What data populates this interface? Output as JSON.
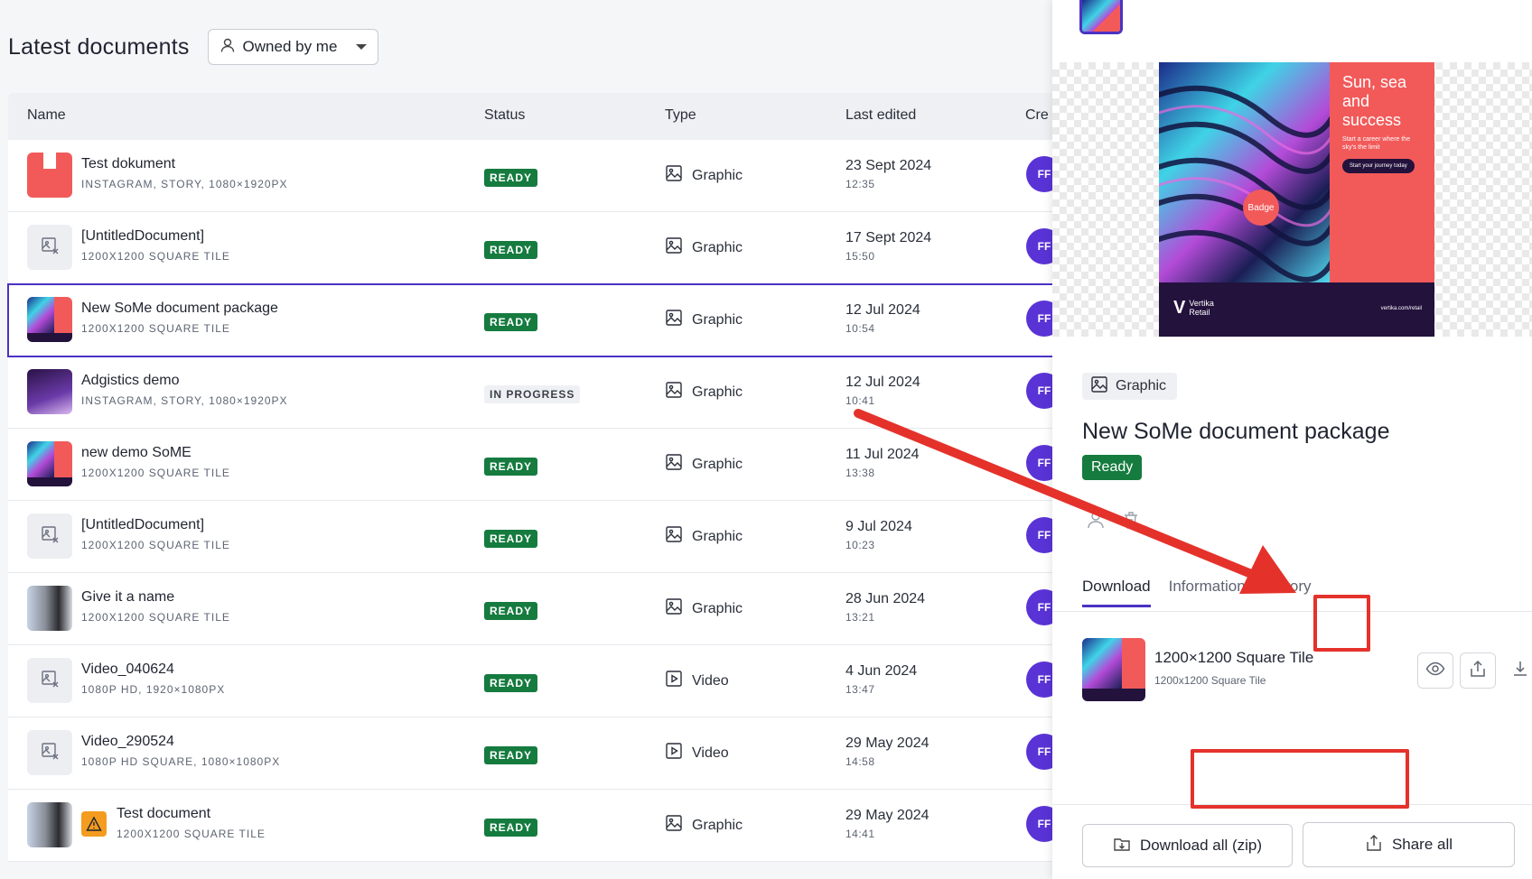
{
  "header": {
    "title": "Latest documents",
    "owner_filter": "Owned by me"
  },
  "columns": {
    "name": "Name",
    "status": "Status",
    "type": "Type",
    "last_edited": "Last edited",
    "created": "Cre"
  },
  "rows": [
    {
      "title": "Test dokument",
      "sub": "INSTAGRAM, STORY, 1080×1920PX",
      "status": "READY",
      "type": "Graphic",
      "date": "23 Sept 2024",
      "time": "12:35",
      "avatar": "FF",
      "thumb": "story-red"
    },
    {
      "title": "[UntitledDocument]",
      "sub": "1200X1200 SQUARE TILE",
      "status": "READY",
      "type": "Graphic",
      "date": "17 Sept 2024",
      "time": "15:50",
      "avatar": "FF",
      "thumb": "placeholder"
    },
    {
      "title": "New SoMe document package",
      "sub": "1200X1200 SQUARE TILE",
      "status": "READY",
      "type": "Graphic",
      "date": "12 Jul 2024",
      "time": "10:54",
      "avatar": "FF",
      "thumb": "poster",
      "selected": true
    },
    {
      "title": "Adgistics demo",
      "sub": "INSTAGRAM, STORY, 1080×1920PX",
      "status": "IN PROGRESS",
      "type": "Graphic",
      "date": "12 Jul 2024",
      "time": "10:41",
      "avatar": "FF",
      "thumb": "purple"
    },
    {
      "title": "new demo SoME",
      "sub": "1200X1200 SQUARE TILE",
      "status": "READY",
      "type": "Graphic",
      "date": "11 Jul 2024",
      "time": "13:38",
      "avatar": "FF",
      "thumb": "poster"
    },
    {
      "title": "[UntitledDocument]",
      "sub": "1200X1200 SQUARE TILE",
      "status": "READY",
      "type": "Graphic",
      "date": "9 Jul 2024",
      "time": "10:23",
      "avatar": "FF",
      "thumb": "placeholder"
    },
    {
      "title": "Give it a name",
      "sub": "1200X1200 SQUARE TILE",
      "status": "READY",
      "type": "Graphic",
      "date": "28 Jun 2024",
      "time": "13:21",
      "avatar": "FF",
      "thumb": "people"
    },
    {
      "title": "Video_040624",
      "sub": "1080P HD, 1920×1080PX",
      "status": "READY",
      "type": "Video",
      "date": "4 Jun 2024",
      "time": "13:47",
      "avatar": "FF",
      "thumb": "placeholder"
    },
    {
      "title": "Video_290524",
      "sub": "1080P HD SQUARE, 1080×1080PX",
      "status": "READY",
      "type": "Video",
      "date": "29 May 2024",
      "time": "14:58",
      "avatar": "FF",
      "thumb": "placeholder"
    },
    {
      "title": "Test document",
      "sub": "1200X1200 SQUARE TILE",
      "status": "READY",
      "type": "Graphic",
      "date": "29 May 2024",
      "time": "14:41",
      "avatar": "FF",
      "thumb": "people",
      "warning": true
    }
  ],
  "panel": {
    "type_label": "Graphic",
    "title": "New SoMe document package",
    "status": "Ready",
    "poster": {
      "headline": "Sun, sea and success",
      "tagline": "Start a career where the sky's the limit",
      "cta": "Start your journey today",
      "badge": "Badge",
      "brand_line1": "Vertika",
      "brand_line2": "Retail",
      "brand_mark": "V",
      "url": "vertika.com/retail"
    },
    "tabs": [
      "Download",
      "Information",
      "History"
    ],
    "active_tab": "Download",
    "file": {
      "name": "1200×1200 Square Tile",
      "sub": "1200x1200 Square Tile"
    },
    "download_all_label": "Download all (zip)",
    "share_all_label": "Share all"
  },
  "colors": {
    "accent": "#4b32c3",
    "ready": "#157b3f",
    "avatar": "#5a33d6",
    "annotation": "#e4322b",
    "poster_red": "#f25a5a",
    "poster_navy": "#23123c"
  }
}
